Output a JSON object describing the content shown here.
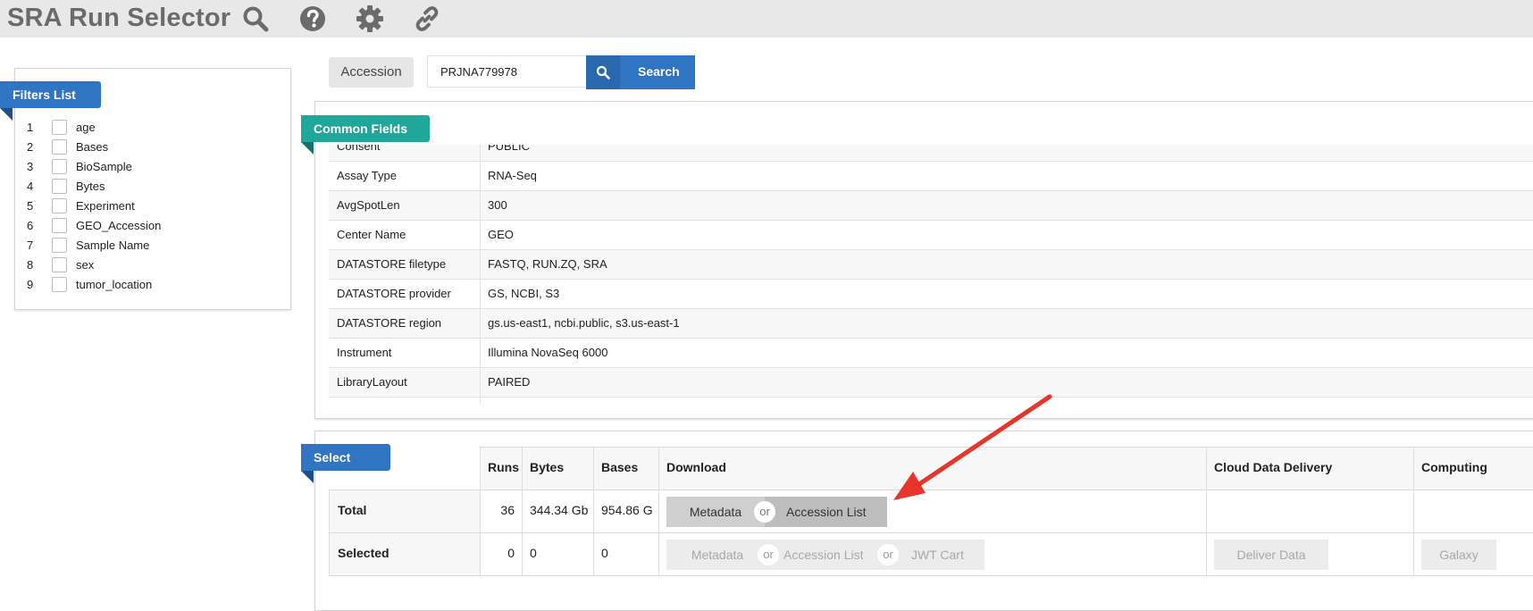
{
  "app": {
    "title": "SRA Run Selector",
    "toolbar_icons": [
      "search-icon",
      "help-icon",
      "gear-icon",
      "link-icon"
    ]
  },
  "search": {
    "label": "Accession",
    "value": "PRJNA779978",
    "button_label": "Search"
  },
  "filters": {
    "title": "Filters List",
    "items": [
      {
        "num": "1",
        "label": "age"
      },
      {
        "num": "2",
        "label": "Bases"
      },
      {
        "num": "3",
        "label": "BioSample"
      },
      {
        "num": "4",
        "label": "Bytes"
      },
      {
        "num": "5",
        "label": "Experiment"
      },
      {
        "num": "6",
        "label": "GEO_Accession"
      },
      {
        "num": "7",
        "label": "Sample Name"
      },
      {
        "num": "8",
        "label": "sex"
      },
      {
        "num": "9",
        "label": "tumor_location"
      }
    ]
  },
  "common_fields": {
    "title": "Common Fields",
    "rows": [
      {
        "key": "Consent",
        "value": "PUBLIC"
      },
      {
        "key": "Assay Type",
        "value": "RNA-Seq"
      },
      {
        "key": "AvgSpotLen",
        "value": "300"
      },
      {
        "key": "Center Name",
        "value": "GEO"
      },
      {
        "key": "DATASTORE filetype",
        "value": "FASTQ, RUN.ZQ, SRA"
      },
      {
        "key": "DATASTORE provider",
        "value": "GS, NCBI, S3"
      },
      {
        "key": "DATASTORE region",
        "value": "gs.us-east1, ncbi.public, s3.us-east-1"
      },
      {
        "key": "Instrument",
        "value": "Illumina NovaSeq 6000"
      },
      {
        "key": "LibraryLayout",
        "value": "PAIRED"
      }
    ]
  },
  "select": {
    "title": "Select",
    "headers": {
      "runs": "Runs",
      "bytes": "Bytes",
      "bases": "Bases",
      "download": "Download",
      "cloud": "Cloud Data Delivery",
      "computing": "Computing"
    },
    "total": {
      "label": "Total",
      "runs": "36",
      "bytes": "344.34 Gb",
      "bases": "954.86 G",
      "metadata": "Metadata",
      "or": "or",
      "accession_list": "Accession List"
    },
    "selected": {
      "label": "Selected",
      "runs": "0",
      "bytes": "0",
      "bases": "0",
      "metadata": "Metadata",
      "or1": "or",
      "accession_list": "Accession List",
      "or2": "or",
      "jwt_cart": "JWT Cart",
      "deliver": "Deliver Data",
      "galaxy": "Galaxy"
    }
  },
  "annotation": {
    "arrow_color": "#e8352b"
  }
}
